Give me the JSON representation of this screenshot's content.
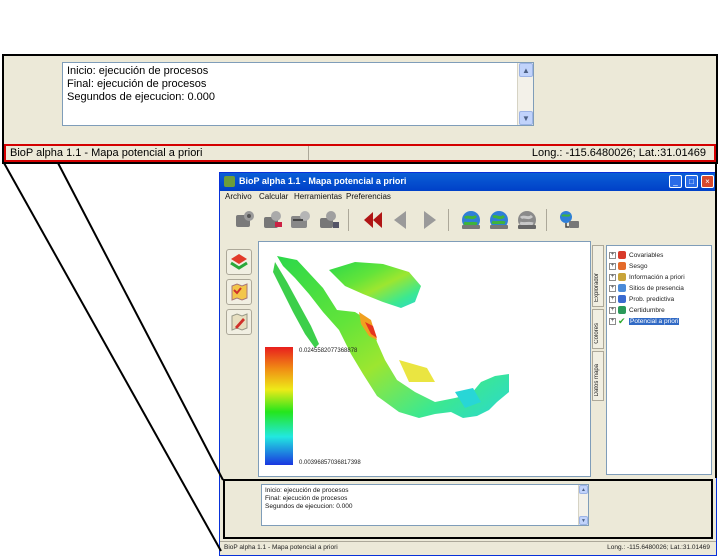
{
  "callout": {
    "log_lines": [
      "Inicio: ejecución de procesos",
      "Final: ejecución de procesos",
      "Segundos de ejecucion: 0.000"
    ],
    "status_left": "BioP alpha 1.1 - Mapa potencial a priori",
    "status_right": "Long.: -115.6480026; Lat.:31.01469"
  },
  "window": {
    "title": "BioP alpha 1.1 - Mapa potencial a priori",
    "menu": [
      "Archivo",
      "Calcular",
      "Herramientas",
      "Preferencias"
    ],
    "toolbar_icons": [
      "process-icon-1",
      "process-icon-2",
      "process-icon-3",
      "process-icon-4",
      "rewind-icon",
      "back-icon",
      "forward-icon",
      "globe-icon-1",
      "globe-icon-2",
      "globe-icon-3",
      "network-icon"
    ],
    "side_tools": [
      "layers-icon",
      "map-tool-icon",
      "edit-map-icon"
    ]
  },
  "map": {
    "legend_max": "0.0245582077368878",
    "legend_min": "0.00396857036817398"
  },
  "tabs": [
    "Explorador",
    "Colores",
    "Datos mapa"
  ],
  "tree": {
    "items": [
      {
        "label": "Covariables",
        "selected": false
      },
      {
        "label": "Sesgo",
        "selected": false
      },
      {
        "label": "Información a priori",
        "selected": false
      },
      {
        "label": "Sitios de presencia",
        "selected": false
      },
      {
        "label": "Prob. predictiva",
        "selected": false
      },
      {
        "label": "Certidumbre",
        "selected": false
      },
      {
        "label": "Potencial a priori",
        "selected": true
      }
    ]
  },
  "log": {
    "lines": [
      "Inicio: ejecución de procesos",
      "Final: ejecución de procesos",
      "Segundos de ejecucion: 0.000"
    ]
  },
  "status": {
    "left": "BioP alpha 1.1 - Mapa potencial a priori",
    "right": "Long.: -115.6480026; Lat.:31.01469"
  },
  "colors": {
    "titlebar": "#0a5fd6",
    "highlight_border": "#d40000",
    "selection": "#316ac5"
  }
}
